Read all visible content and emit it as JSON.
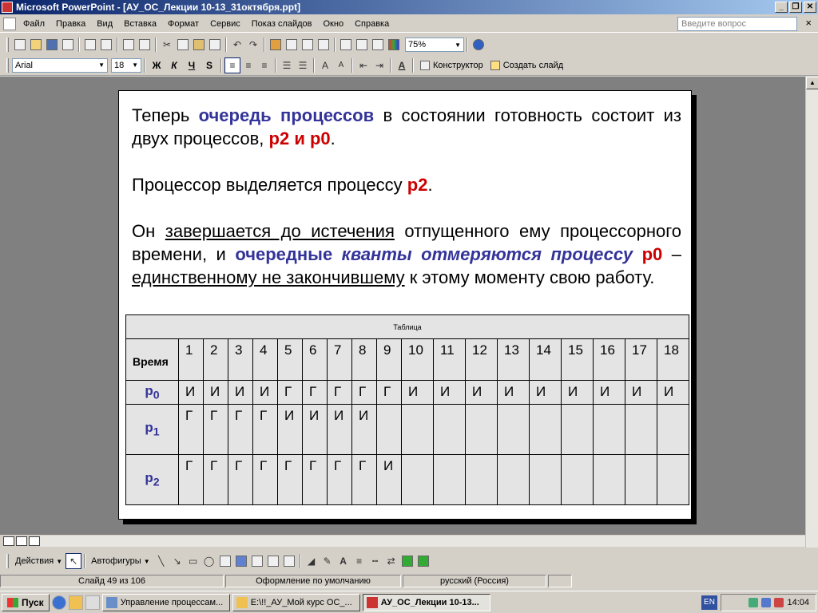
{
  "window": {
    "title": "Microsoft PowerPoint - [АУ_ОС_Лекции 10-13_31октября.ppt]",
    "controls": [
      "_",
      "❐",
      "✕"
    ]
  },
  "menu": {
    "items": [
      "Файл",
      "Правка",
      "Вид",
      "Вставка",
      "Формат",
      "Сервис",
      "Показ слайдов",
      "Окно",
      "Справка"
    ],
    "ask_placeholder": "Введите вопрос",
    "close_doc": "×"
  },
  "toolbar_standard": {
    "zoom": "75%"
  },
  "toolbar_format": {
    "font": "Arial",
    "size": "18",
    "bold": "Ж",
    "italic": "К",
    "underline": "Ч",
    "shadow": "S",
    "designer": "Конструктор",
    "new_slide": "Создать слайд"
  },
  "slide": {
    "para1": {
      "a": "Теперь ",
      "b": "очередь процессов",
      "c": " в состоянии готовность состоит из двух процессов, ",
      "d": "р2 и р0",
      "e": "."
    },
    "para2": {
      "a": "Процессор выделяется процессу ",
      "b": "р2",
      "c": "."
    },
    "para3": {
      "a": "Он ",
      "b": "завершается до истечения",
      "c": " отпущенного ему процессорного времени, и ",
      "d": "очередные",
      "e": " ",
      "f": "кванты отмеряются процессу",
      "g": " ",
      "h": "р0",
      "i": " – ",
      "j": "единственному не закончившему",
      "k": " к этому моменту свою работу."
    },
    "table": {
      "caption": "Таблица",
      "time_label": "Время",
      "columns": [
        "1",
        "2",
        "3",
        "4",
        "5",
        "6",
        "7",
        "8",
        "9",
        "10",
        "11",
        "12",
        "13",
        "14",
        "15",
        "16",
        "17",
        "18"
      ],
      "rows": [
        {
          "name": "р0",
          "cells": [
            "И",
            "И",
            "И",
            "И",
            "Г",
            "Г",
            "Г",
            "Г",
            "Г",
            "И",
            "И",
            "И",
            "И",
            "И",
            "И",
            "И",
            "И",
            "И"
          ]
        },
        {
          "name": "р1",
          "cells": [
            "Г",
            "Г",
            "Г",
            "Г",
            "И",
            "И",
            "И",
            "И",
            "",
            "",
            "",
            "",
            "",
            "",
            "",
            "",
            "",
            ""
          ]
        },
        {
          "name": "р2",
          "cells": [
            "Г",
            "Г",
            "Г",
            "Г",
            "Г",
            "Г",
            "Г",
            "Г",
            "И",
            "",
            "",
            "",
            "",
            "",
            "",
            "",
            "",
            ""
          ]
        }
      ]
    }
  },
  "drawbar": {
    "actions": "Действия",
    "autoshapes": "Автофигуры"
  },
  "status": {
    "slide": "Слайд 49 из 106",
    "design": "Оформление по умолчанию",
    "lang": "русский (Россия)"
  },
  "taskbar": {
    "start": "Пуск",
    "tasks": [
      "Управление процессам...",
      "E:\\!!_АУ_Мой курс ОС_...",
      "АУ_ОС_Лекции 10-13..."
    ],
    "lang": "EN",
    "clock": "14:04"
  }
}
